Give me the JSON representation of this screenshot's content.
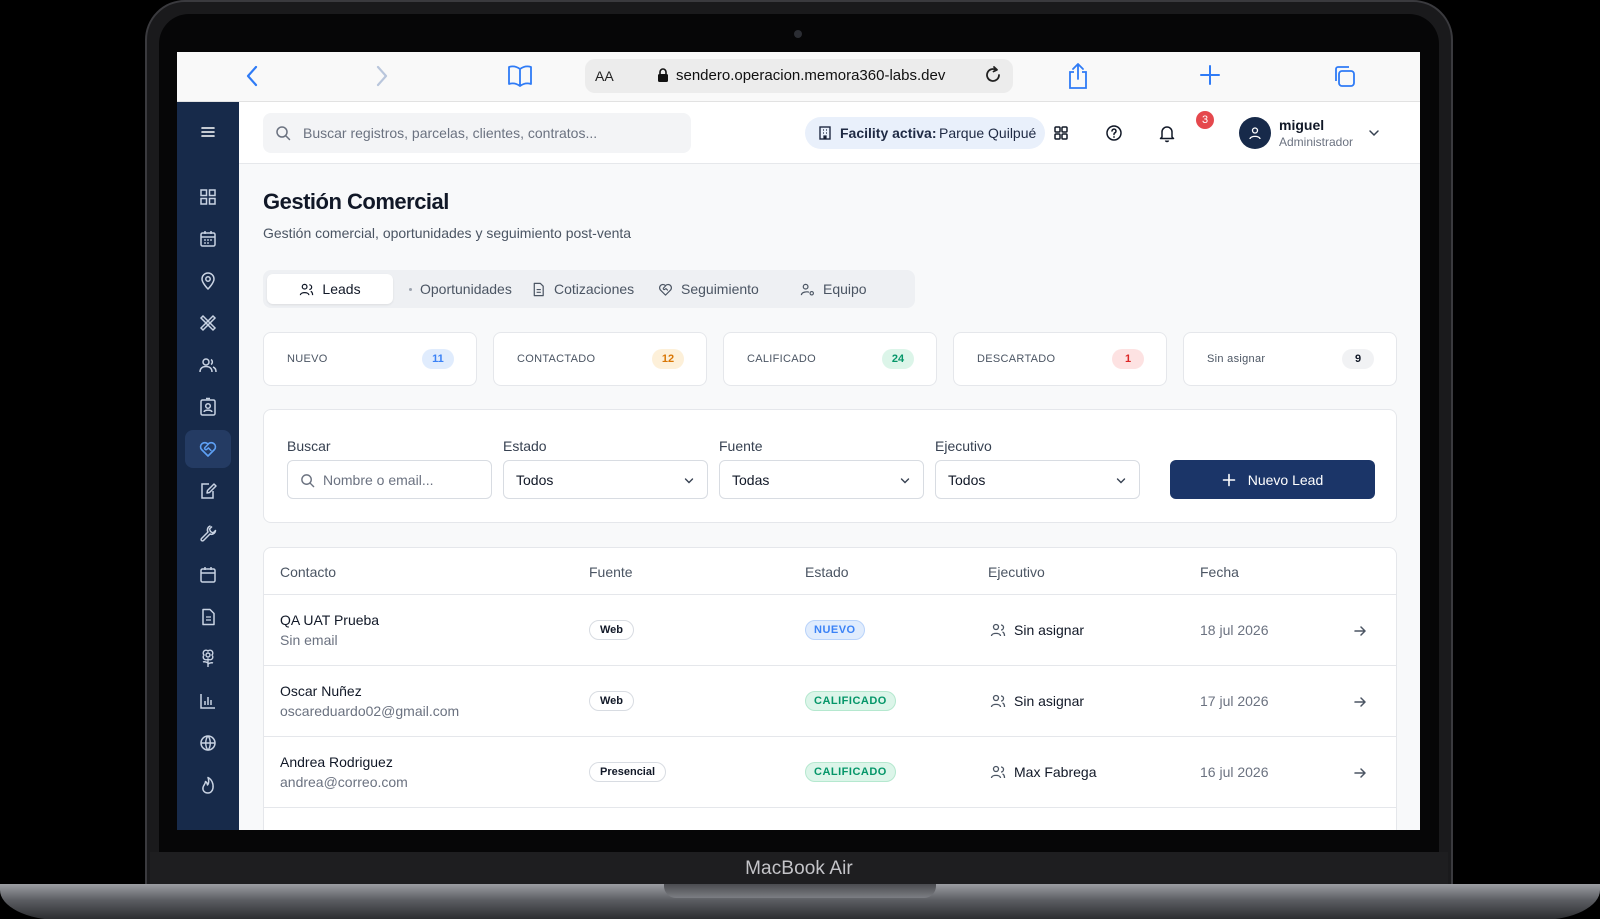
{
  "device": {
    "brand_label": "MacBook Air"
  },
  "browser": {
    "text_size_label": "AA",
    "url": "sendero.operacion.memora360-labs.dev"
  },
  "header": {
    "search_placeholder": "Buscar registros, parcelas, clientes, contratos...",
    "facility_label": "Facility activa:",
    "facility_value": "Parque Quilpué",
    "notifications_count": "3",
    "user_name": "miguel",
    "user_role": "Administrador"
  },
  "page": {
    "title": "Gestión Comercial",
    "subtitle": "Gestión comercial, oportunidades y seguimiento post-venta"
  },
  "tabs": [
    {
      "label": "Leads",
      "icon": "users-icon",
      "active": true
    },
    {
      "label": "Oportunidades",
      "icon": "dot-icon",
      "active": false
    },
    {
      "label": "Cotizaciones",
      "icon": "document-icon",
      "active": false
    },
    {
      "label": "Seguimiento",
      "icon": "heart-handshake-icon",
      "active": false
    },
    {
      "label": "Equipo",
      "icon": "user-cog-icon",
      "active": false
    }
  ],
  "stats": [
    {
      "label": "NUEVO",
      "count": "11",
      "color": "#3b82f6",
      "bg": "#e0ecfd"
    },
    {
      "label": "CONTACTADO",
      "count": "12",
      "color": "#d97706",
      "bg": "#fdf0d9"
    },
    {
      "label": "CALIFICADO",
      "count": "24",
      "color": "#059669",
      "bg": "#dcf5e9"
    },
    {
      "label": "DESCARTADO",
      "count": "1",
      "color": "#dc2626",
      "bg": "#fde2e2"
    },
    {
      "label": "Sin asignar",
      "count": "9",
      "color": "#111827",
      "bg": "#f1f2f4"
    }
  ],
  "filters": {
    "search_label": "Buscar",
    "search_placeholder": "Nombre o email...",
    "status_label": "Estado",
    "status_value": "Todos",
    "source_label": "Fuente",
    "source_value": "Todas",
    "executive_label": "Ejecutivo",
    "executive_value": "Todos",
    "new_lead_label": "Nuevo Lead"
  },
  "table": {
    "columns": [
      "Contacto",
      "Fuente",
      "Estado",
      "Ejecutivo",
      "Fecha"
    ],
    "rows": [
      {
        "name": "QA UAT Prueba",
        "email": "Sin email",
        "source": "Web",
        "status": "NUEVO",
        "status_color": "#3b82f6",
        "status_bg": "#e0ecfd",
        "executive": "Sin asignar",
        "date": "18 jul 2026"
      },
      {
        "name": "Oscar Nuñez",
        "email": "oscareduardo02@gmail.com",
        "source": "Web",
        "status": "CALIFICADO",
        "status_color": "#059669",
        "status_bg": "#dcf5e9",
        "executive": "Sin asignar",
        "date": "17 jul 2026"
      },
      {
        "name": "Andrea Rodriguez",
        "email": "andrea@correo.com",
        "source": "Presencial",
        "status": "CALIFICADO",
        "status_color": "#059669",
        "status_bg": "#dcf5e9",
        "executive": "Max Fabrega",
        "date": "16 jul 2026"
      }
    ]
  },
  "colors": {
    "sidebar_bg": "#172a4a",
    "primary": "#1b3568",
    "accent_active_icon": "#5ea0f5"
  }
}
